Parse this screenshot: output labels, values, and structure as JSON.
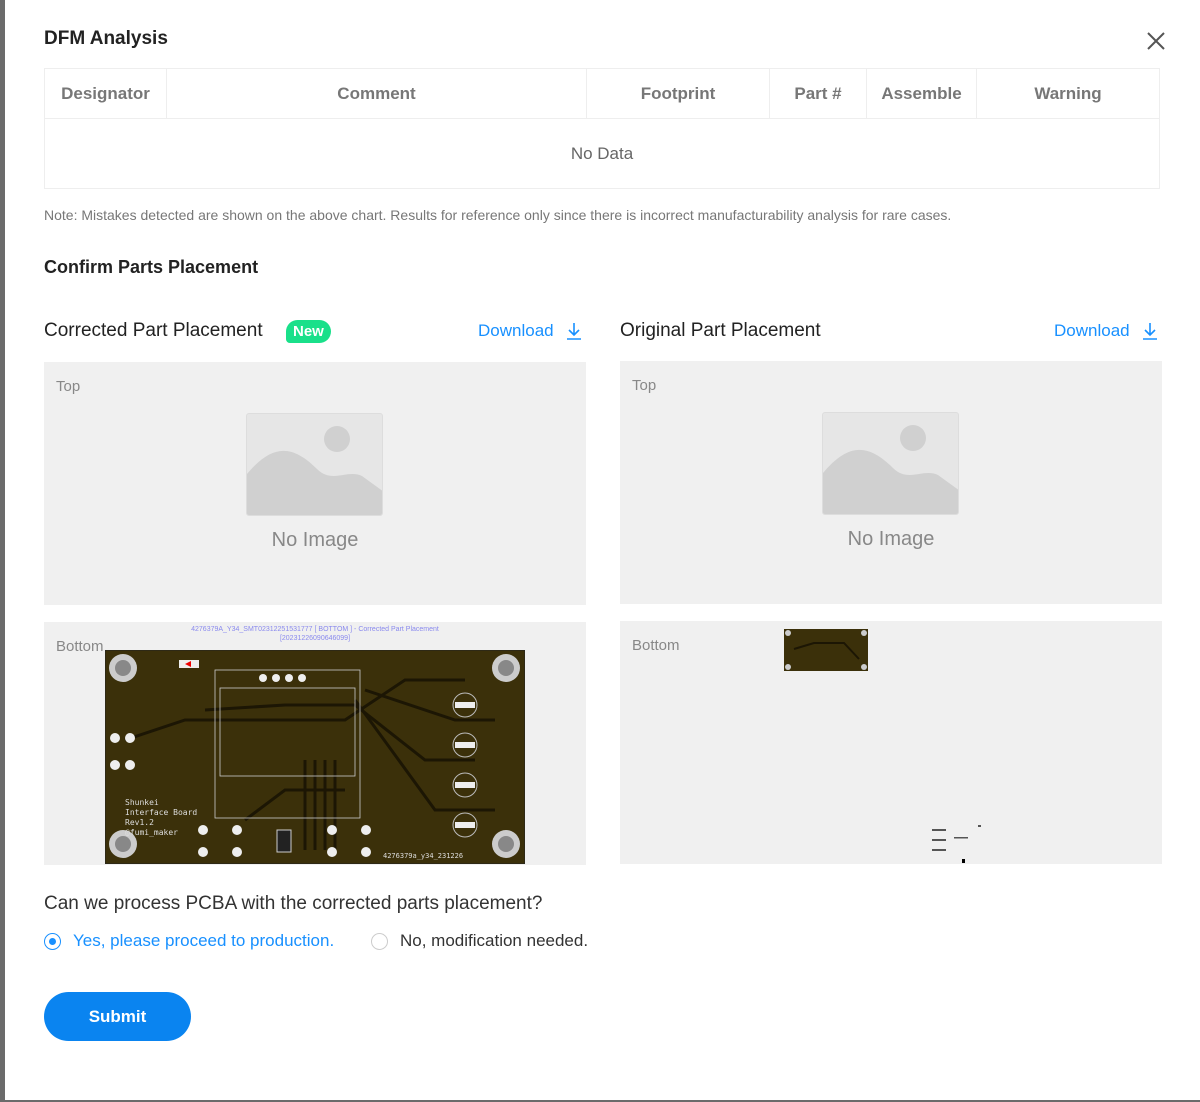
{
  "dialog": {
    "title": "DFM Analysis",
    "close_icon": "close-icon"
  },
  "table": {
    "columns": [
      "Designator",
      "Comment",
      "Footprint",
      "Part #",
      "Assemble",
      "Warning"
    ],
    "empty_text": "No Data"
  },
  "note": "Note: Mistakes detected are shown on the above chart. Results for reference only since there is incorrect manufacturability analysis for rare cases.",
  "section_title": "Confirm Parts Placement",
  "corrected": {
    "title": "Corrected Part Placement",
    "badge": "New",
    "download": "Download",
    "top_label": "Top",
    "no_image": "No Image",
    "bottom_label": "Bottom",
    "image_caption_1": "4276379A_Y34_SMT02312251531777 [ BOTTOM ] - Corrected Part Placement",
    "image_caption_2": "[20231226090646099]",
    "silkscreen": [
      "Shunkei",
      "Interface Board",
      "Rev1.2",
      "@fumi_maker"
    ],
    "board_id": "4276379a_y34_231226"
  },
  "original": {
    "title": "Original Part Placement",
    "download": "Download",
    "top_label": "Top",
    "no_image": "No Image",
    "bottom_label": "Bottom"
  },
  "question": "Can we process PCBA with the corrected parts placement?",
  "options": [
    {
      "label": "Yes, please proceed to production.",
      "selected": true,
      "color": "#1890ff"
    },
    {
      "label": "No, modification needed.",
      "selected": false
    }
  ],
  "submit": "Submit",
  "colors": {
    "accent": "#1890ff",
    "badge": "#19e08a",
    "board": "#3b300a"
  }
}
